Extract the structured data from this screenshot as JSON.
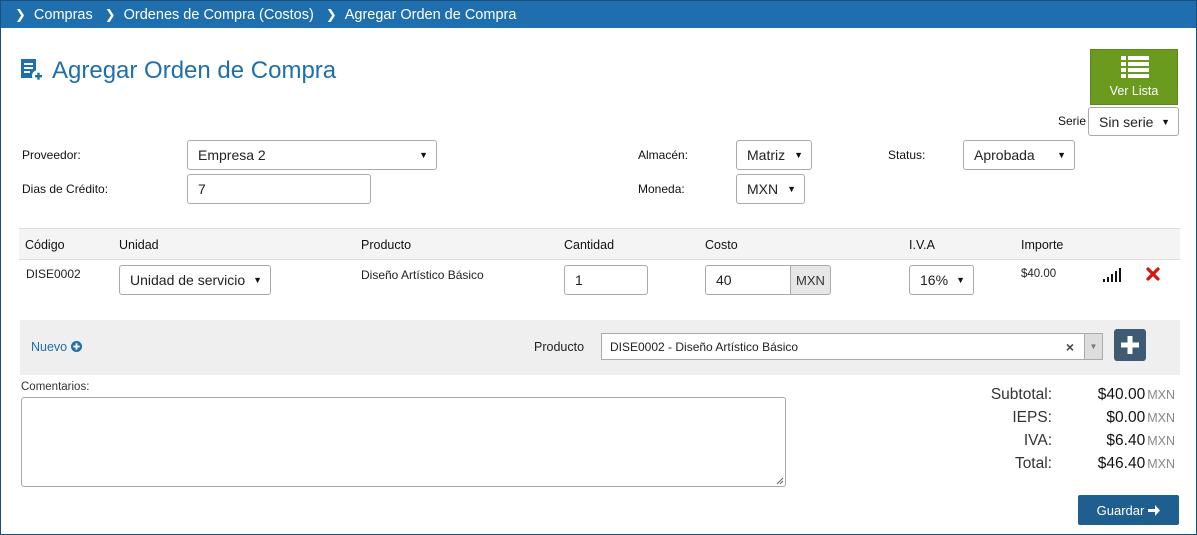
{
  "breadcrumb": [
    "Compras",
    "Ordenes de Compra (Costos)",
    "Agregar Orden de Compra"
  ],
  "page": {
    "title": "Agregar Orden de Compra"
  },
  "ver_lista": {
    "label": "Ver Lista"
  },
  "serie": {
    "label": "Serie",
    "value": "Sin serie"
  },
  "form": {
    "proveedor_label": "Proveedor:",
    "proveedor_value": "Empresa 2",
    "dias_label": "Dias de Crédito:",
    "dias_value": "7",
    "almacen_label": "Almacén:",
    "almacen_value": "Matriz",
    "moneda_label": "Moneda:",
    "moneda_value": "MXN",
    "status_label": "Status:",
    "status_value": "Aprobada"
  },
  "table": {
    "headers": [
      "Código",
      "Unidad",
      "Producto",
      "Cantidad",
      "Costo",
      "I.V.A",
      "Importe"
    ],
    "row": {
      "codigo": "DISE0002",
      "unidad": "Unidad de servicio",
      "producto": "Diseño Artístico Básico",
      "cantidad": "1",
      "costo": "40",
      "costo_currency": "MXN",
      "iva": "16%",
      "importe": "$40.00"
    }
  },
  "product_bar": {
    "nuevo_label": "Nuevo",
    "producto_label": "Producto",
    "producto_value": "DISE0002 - Diseño Artístico Básico",
    "clear": "×"
  },
  "comentarios": {
    "label": "Comentarios:"
  },
  "totals": {
    "subtotal_label": "Subtotal:",
    "subtotal_value": "$40.00",
    "ieps_label": "IEPS:",
    "ieps_value": "$0.00",
    "iva_label": "IVA:",
    "iva_value": "$6.40",
    "total_label": "Total:",
    "total_value": "$46.40",
    "currency": "MXN"
  },
  "guardar": {
    "label": "Guardar"
  },
  "colors": {
    "brand": "#1f6fae",
    "verde": "#6a9a1e",
    "danger": "#d9140f",
    "save": "#1f5f8f"
  }
}
